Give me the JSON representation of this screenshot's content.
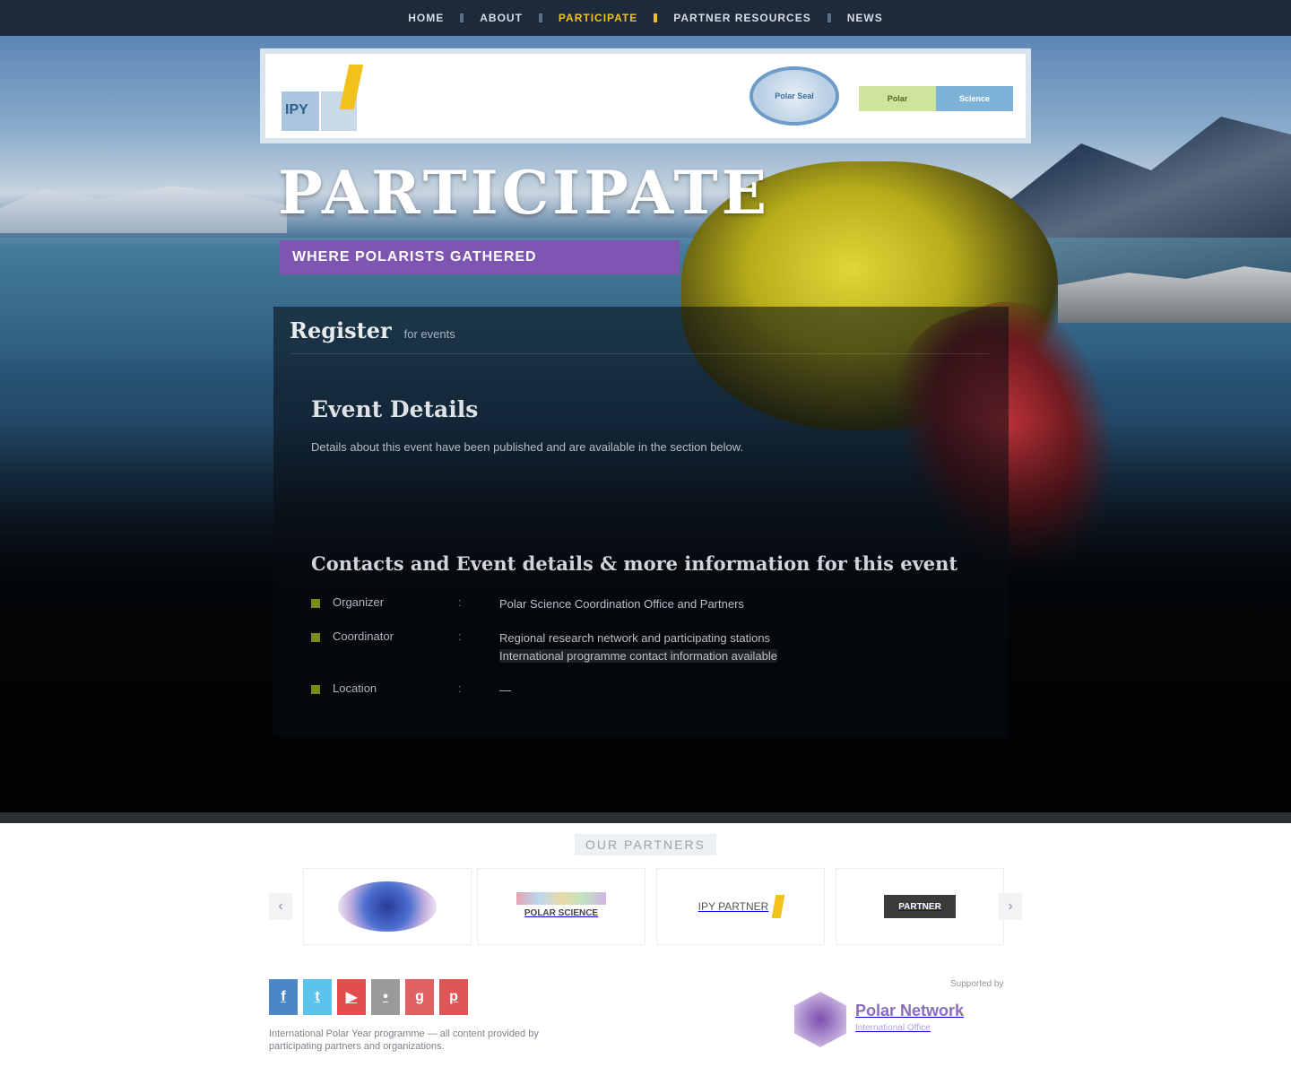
{
  "nav": {
    "items": [
      {
        "label": "Home",
        "active": false
      },
      {
        "label": "About",
        "active": false
      },
      {
        "label": "Participate",
        "active": true
      },
      {
        "label": "Partner Resources",
        "active": false
      },
      {
        "label": "News",
        "active": false
      }
    ]
  },
  "header": {
    "logo_text": "IPY",
    "seal_text": "Polar Seal",
    "badge_left": "Polar",
    "badge_right": "Science"
  },
  "hero": {
    "title": "PARTICIPATE",
    "subtitle": "Where Polarists Gathered"
  },
  "panel": {
    "register_title": "Register",
    "register_sub": "for events",
    "section_heading": "Event Details",
    "section_text": "Details about this event have been published and are available in the section below.",
    "contact_heading": "Contacts and Event details & more information for this event",
    "contacts": [
      {
        "label": "Organizer",
        "value": "Polar Science Coordination Office and Partners",
        "extra": ""
      },
      {
        "label": "Coordinator",
        "value": "Regional research network and participating stations",
        "extra": "International programme contact information available"
      },
      {
        "label": "Location",
        "value": "—",
        "extra": ""
      }
    ]
  },
  "partners": {
    "title": "Our Partners",
    "prev": "‹",
    "next": "›",
    "logo2_text": "POLAR SCIENCE",
    "logo3_text": "IPY PARTNER",
    "logo4_text": "PARTNER"
  },
  "footer": {
    "social": [
      "f",
      "t",
      "▶",
      "•",
      "g",
      "p"
    ],
    "text": "International Polar Year programme — all content provided by participating partners and organizations.",
    "right_label": "Supported by",
    "brand_name": "Polar Network",
    "brand_sub": "International Office"
  },
  "colors": {
    "accent_gold": "#f2c11a",
    "accent_purple": "#7f55b2",
    "nav_bg": "#1c2a3c"
  }
}
